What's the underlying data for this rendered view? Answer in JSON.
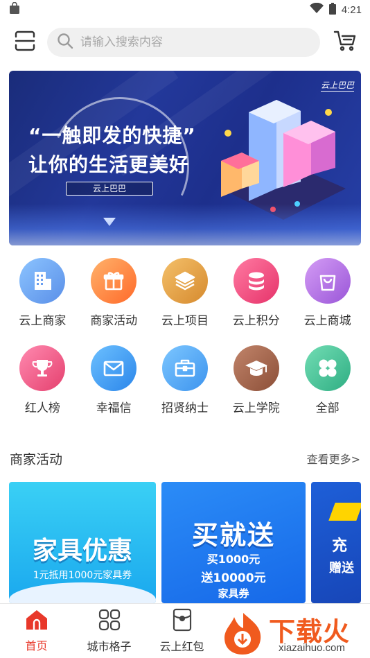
{
  "status_bar": {
    "time": "4:21",
    "icons": [
      "bag-icon",
      "wifi-icon",
      "battery-icon"
    ]
  },
  "header": {
    "scan_icon": "scan-icon",
    "search_placeholder": "请输入搜索内容",
    "cart_icon": "cart-icon"
  },
  "banner": {
    "line1": "“一触即发的快捷”",
    "line2": "让你的生活更美好",
    "brand": "云上巴巴",
    "logo": "云上巴巴"
  },
  "categories": [
    {
      "label": "云上商家",
      "icon": "building-icon",
      "color": "#6ea8f2"
    },
    {
      "label": "商家活动",
      "icon": "gift-icon",
      "color": "#ff8a3c"
    },
    {
      "label": "云上项目",
      "icon": "layers-icon",
      "color": "#e9a545"
    },
    {
      "label": "云上积分",
      "icon": "coins-icon",
      "color": "#f0507e"
    },
    {
      "label": "云上商城",
      "icon": "shopping-bag-icon",
      "color": "#b06fe0"
    },
    {
      "label": "红人榜",
      "icon": "trophy-icon",
      "color": "#f05a83"
    },
    {
      "label": "幸福信",
      "icon": "mail-icon",
      "color": "#3b9ff0"
    },
    {
      "label": "招贤纳士",
      "icon": "briefcase-icon",
      "color": "#4aa6f2"
    },
    {
      "label": "云上学院",
      "icon": "graduation-cap-icon",
      "color": "#a4624a"
    },
    {
      "label": "全部",
      "icon": "clover-icon",
      "color": "#4bc69a"
    }
  ],
  "activities": {
    "title": "商家活动",
    "more": "查看更多>",
    "cards": [
      {
        "headline": "家具优惠",
        "sub": "1元抵用1000元家具券"
      },
      {
        "headline": "买就送",
        "sub1": "买1000元",
        "sub2": "送10000元",
        "sub3": "家具券"
      },
      {
        "line1": "充",
        "line2": "赠送"
      }
    ]
  },
  "tabbar": {
    "tabs": [
      {
        "label": "首页",
        "icon": "home-icon",
        "active": true
      },
      {
        "label": "城市格子",
        "icon": "grid-icon",
        "active": false
      },
      {
        "label": "云上红包",
        "icon": "red-packet-icon",
        "active": false
      }
    ]
  },
  "watermark": {
    "text": "下载火",
    "url": "xiazaihuo.com"
  },
  "colors": {
    "accent": "#e8382a",
    "banner_bg": "#23389a"
  }
}
